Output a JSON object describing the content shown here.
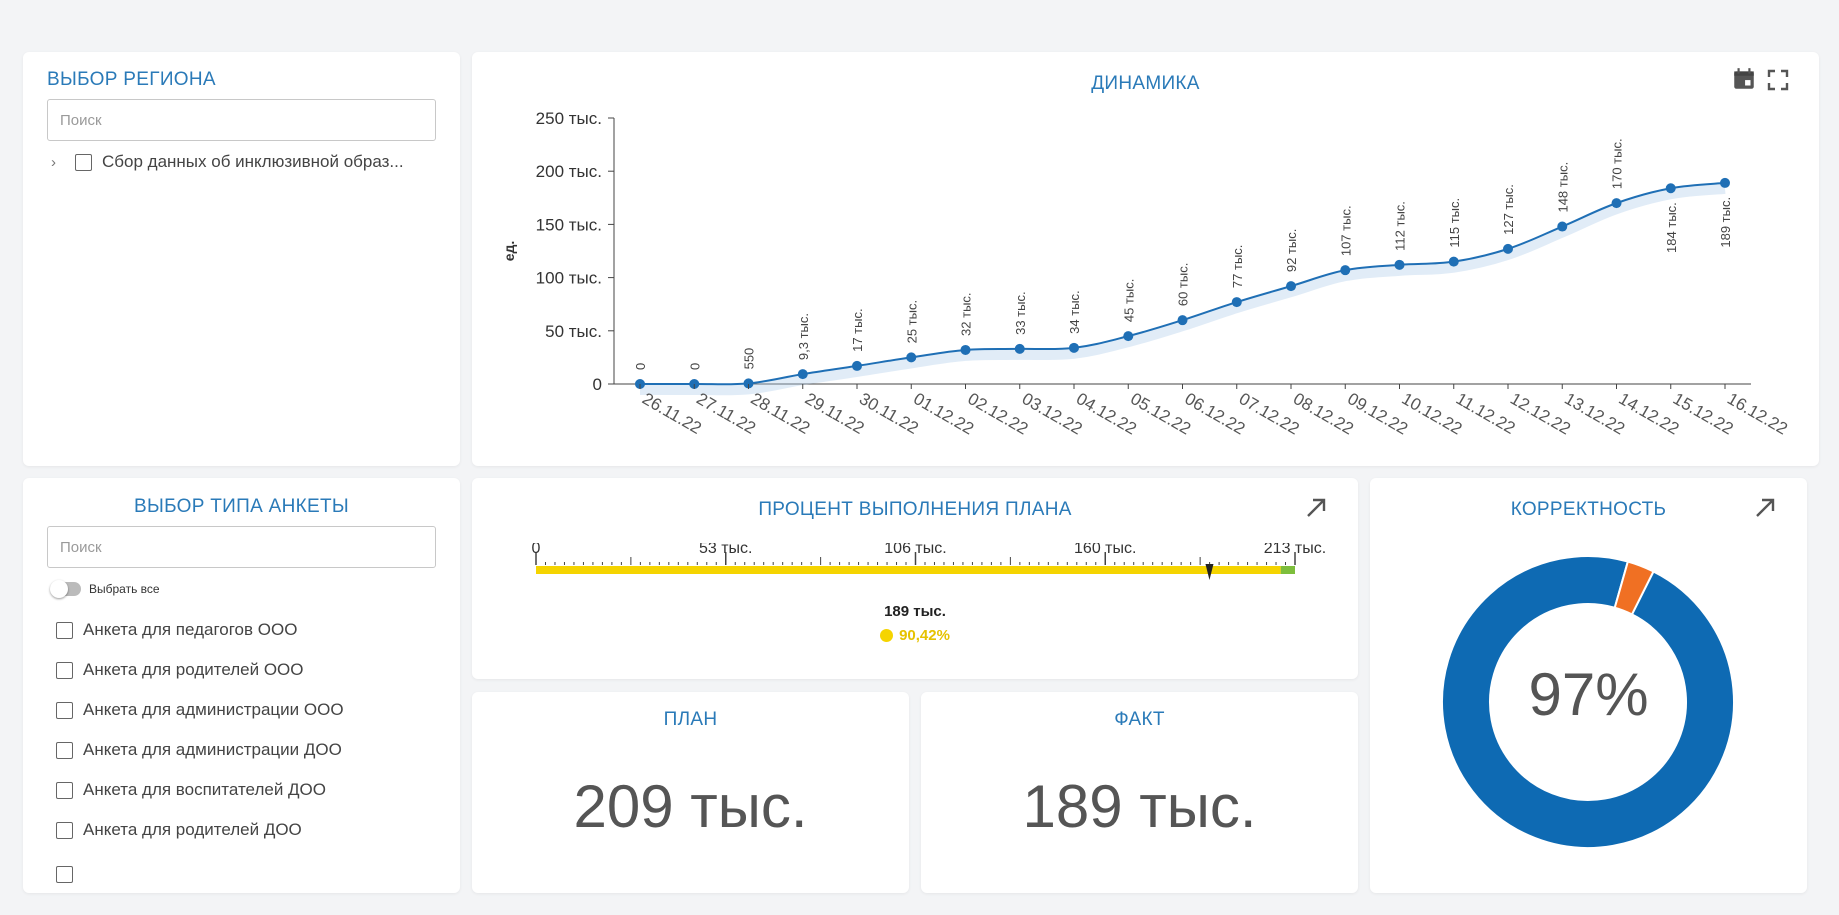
{
  "region": {
    "title": "Выбор региона",
    "search_placeholder": "Поиск",
    "tree_item": "Сбор данных об инклюзивной образ..."
  },
  "dynamics": {
    "title": "Динамика",
    "icons": [
      "calendar-icon",
      "fullscreen-icon"
    ],
    "chart_data": {
      "type": "line",
      "title": "ДИНАМИКА",
      "ylabel": "ед.",
      "xlabel": "",
      "ylim": [
        0,
        250000
      ],
      "yticks": [
        0,
        50000,
        100000,
        150000,
        200000,
        250000
      ],
      "ytick_labels": [
        "0",
        "50 тыс.",
        "100 тыс.",
        "150 тыс.",
        "200 тыс.",
        "250 тыс."
      ],
      "x": [
        "26.11.22",
        "27.11.22",
        "28.11.22",
        "29.11.22",
        "30.11.22",
        "01.12.22",
        "02.12.22",
        "03.12.22",
        "04.12.22",
        "05.12.22",
        "06.12.22",
        "07.12.22",
        "08.12.22",
        "09.12.22",
        "10.12.22",
        "11.12.22",
        "12.12.22",
        "13.12.22",
        "14.12.22",
        "15.12.22",
        "16.12.22"
      ],
      "values": [
        0,
        0,
        550,
        9300,
        17000,
        25000,
        32000,
        33000,
        34000,
        45000,
        60000,
        77000,
        92000,
        107000,
        112000,
        115000,
        127000,
        148000,
        170000,
        184000,
        189000
      ],
      "data_labels": [
        "0",
        "0",
        "550",
        "9,3 тыс.",
        "17 тыс.",
        "25 тыс.",
        "32 тыс.",
        "33 тыс.",
        "34 тыс.",
        "45 тыс.",
        "60 тыс.",
        "77 тыс.",
        "92 тыс.",
        "107 тыс.",
        "112 тыс.",
        "115 тыс.",
        "127 тыс.",
        "148 тыс.",
        "170 тыс.",
        "184 тыс.",
        "189 тыс."
      ],
      "grid": false,
      "color": "#1f6fb5"
    }
  },
  "questionnaire": {
    "title": "Выбор типа анкеты",
    "search_placeholder": "Поиск",
    "select_all": "Выбрать все",
    "items": [
      "Анкета для педагогов ООО",
      "Анкета для родителей ООО",
      "Анкета для администрации ООО",
      "Анкета для администрации ДОО",
      "Анкета для воспитателей ДОО",
      "Анкета для родителей ДОО"
    ]
  },
  "plan_percent": {
    "title": "Процент выполнения плана",
    "scale_labels": [
      "0",
      "53 тыс.",
      "106 тыс.",
      "160 тыс.",
      "213 тыс."
    ],
    "scale_max": 213000,
    "fact": 189000,
    "plan": 209000,
    "value_label": "189 тыс.",
    "percent_label": "90,42%",
    "bar_color": "#f5d400",
    "plan_color": "#7dbe3c"
  },
  "plan": {
    "title": "План",
    "value": "209 тыс."
  },
  "fact": {
    "title": "Факт",
    "value": "189 тыс."
  },
  "correctness": {
    "title": "Корректность",
    "value": "97%",
    "segments": [
      {
        "fraction": 0.97,
        "color": "#0e6ab3"
      },
      {
        "fraction": 0.03,
        "color": "#f07023"
      }
    ]
  }
}
